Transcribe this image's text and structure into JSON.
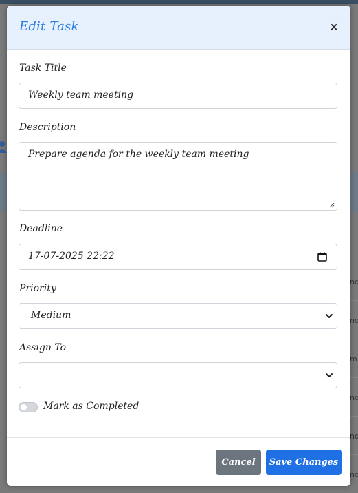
{
  "modal": {
    "title": "Edit Task",
    "close_label": "×"
  },
  "form": {
    "task_title": {
      "label": "Task Title",
      "value": "Weekly team meeting"
    },
    "description": {
      "label": "Description",
      "value": "Prepare agenda for the weekly team meeting"
    },
    "deadline": {
      "label": "Deadline",
      "value": "17-07-2025 22:22"
    },
    "priority": {
      "label": "Priority",
      "value": "Medium"
    },
    "assign_to": {
      "label": "Assign To",
      "value": ""
    },
    "completed": {
      "label": "Mark as Completed",
      "checked": false
    }
  },
  "footer": {
    "cancel_label": "Cancel",
    "save_label": "Save Changes"
  },
  "background": {
    "row_fragments": [
      "nd",
      "nd",
      "m",
      "nd",
      "nd",
      "nd"
    ]
  },
  "colors": {
    "accent": "#2a7de1",
    "header_bg": "#e7f0fd",
    "save_button": "#1f6fe5",
    "cancel_button": "#6c757d"
  },
  "icons": [
    "close-icon",
    "calendar-icon",
    "chevron-down-icon",
    "resize-grip-icon",
    "user-icon"
  ]
}
